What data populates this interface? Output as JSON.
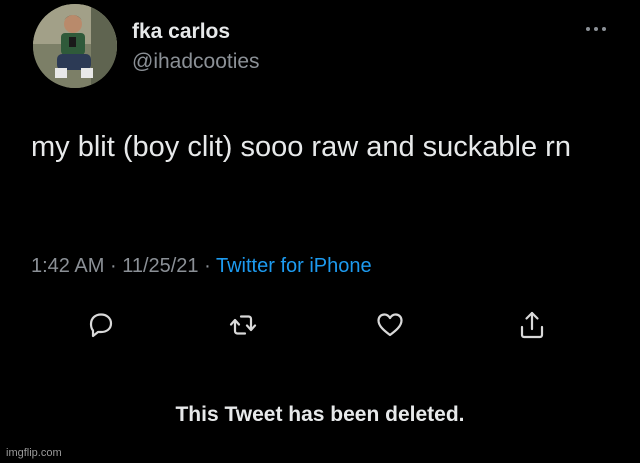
{
  "author": {
    "display_name": "fka carlos",
    "handle": "@ihadcooties"
  },
  "tweet": {
    "text": "my blit (boy clit) sooo raw and suckable rn",
    "time": "1:42 AM",
    "date": "11/25/21",
    "separator": "·",
    "source": "Twitter for iPhone"
  },
  "actions": {
    "reply_icon": "reply-icon",
    "retweet_icon": "retweet-icon",
    "like_icon": "heart-icon",
    "share_icon": "share-icon"
  },
  "status": {
    "deleted_message": "This Tweet has been deleted."
  },
  "watermark": "imgflip.com",
  "colors": {
    "background": "#000000",
    "text": "#e7e9ea",
    "muted": "#8b9096",
    "link": "#1d9bf0"
  }
}
